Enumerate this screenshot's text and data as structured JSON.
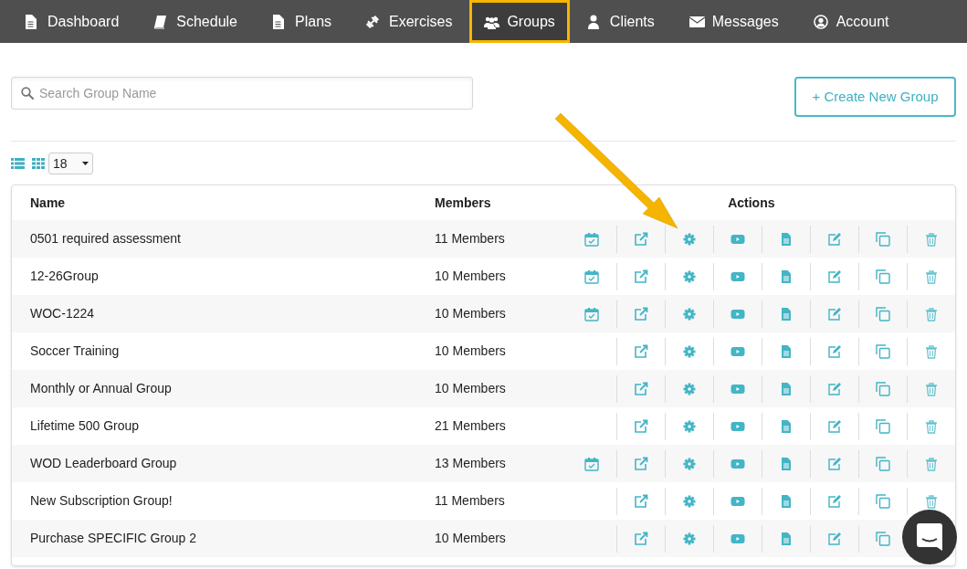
{
  "nav": [
    {
      "label": "Dashboard",
      "selected": false
    },
    {
      "label": "Schedule",
      "selected": false
    },
    {
      "label": "Plans",
      "selected": false
    },
    {
      "label": "Exercises",
      "selected": false
    },
    {
      "label": "Groups",
      "selected": true
    },
    {
      "label": "Clients",
      "selected": false
    },
    {
      "label": "Messages",
      "selected": false
    },
    {
      "label": "Account",
      "selected": false
    }
  ],
  "search": {
    "placeholder": "Search Group Name"
  },
  "create_button": "+ Create New Group",
  "page_size": "18",
  "table": {
    "columns": [
      "Name",
      "Members",
      "Actions"
    ],
    "rows": [
      {
        "name": "0501 required assessment",
        "members": "11 Members",
        "calendar": true
      },
      {
        "name": "12-26Group",
        "members": "10 Members",
        "calendar": true
      },
      {
        "name": "WOC-1224",
        "members": "10 Members",
        "calendar": true
      },
      {
        "name": "Soccer Training",
        "members": "10 Members",
        "calendar": false
      },
      {
        "name": "Monthly or Annual Group",
        "members": "10 Members",
        "calendar": false
      },
      {
        "name": "Lifetime 500 Group",
        "members": "21 Members",
        "calendar": false
      },
      {
        "name": "WOD Leaderboard Group",
        "members": "13 Members",
        "calendar": true
      },
      {
        "name": "New Subscription Group!",
        "members": "11 Members",
        "calendar": false
      },
      {
        "name": "Purchase SPECIFIC Group 2",
        "members": "10 Members",
        "calendar": false
      }
    ]
  }
}
